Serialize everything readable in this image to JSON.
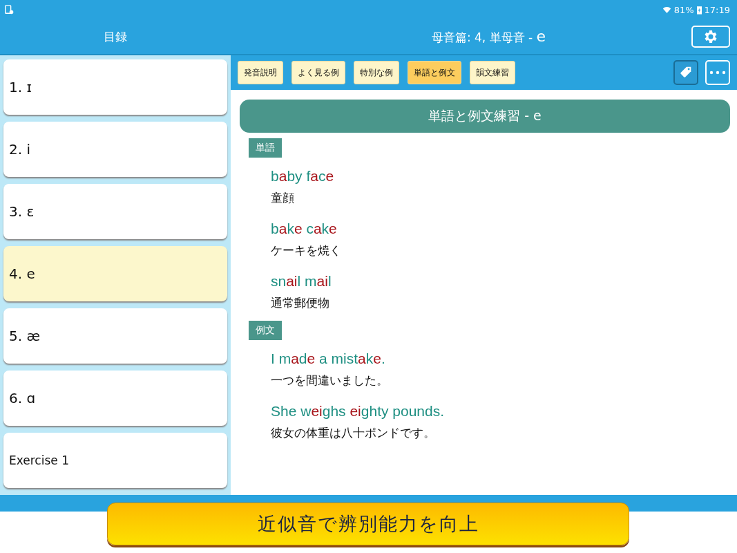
{
  "status_bar": {
    "battery": "81%",
    "time": "17:19"
  },
  "header": {
    "sidebar_title": "目録",
    "title": "母音篇: 4,  単母音 - ",
    "title_symbol": "e"
  },
  "sidebar": {
    "items": [
      {
        "label": "1. ɪ",
        "selected": false
      },
      {
        "label": "2. i",
        "selected": false
      },
      {
        "label": "3. ɛ",
        "selected": false
      },
      {
        "label": "4. e",
        "selected": true
      },
      {
        "label": "5. æ",
        "selected": false
      },
      {
        "label": "6. ɑ",
        "selected": false
      },
      {
        "label": "Exercise 1",
        "selected": false
      }
    ]
  },
  "tabs": [
    {
      "label": "発音説明",
      "selected": false
    },
    {
      "label": "よく見る例",
      "selected": false
    },
    {
      "label": "特別な例",
      "selected": false
    },
    {
      "label": "単語と例文",
      "selected": true
    },
    {
      "label": "韻文練習",
      "selected": false
    }
  ],
  "content": {
    "heading": "単語と例文練習 - e",
    "sections": [
      {
        "label": "単語",
        "entries": [
          {
            "phrase": [
              {
                "t": "b",
                "hl": false
              },
              {
                "t": "a",
                "hl": true
              },
              {
                "t": "by f",
                "hl": false
              },
              {
                "t": "a",
                "hl": true
              },
              {
                "t": "c",
                "hl": false
              },
              {
                "t": "e",
                "hl": true
              }
            ],
            "meaning": "童顔"
          },
          {
            "phrase": [
              {
                "t": "b",
                "hl": false
              },
              {
                "t": "a",
                "hl": true
              },
              {
                "t": "k",
                "hl": false
              },
              {
                "t": "e",
                "hl": true
              },
              {
                "t": " c",
                "hl": false
              },
              {
                "t": "a",
                "hl": true
              },
              {
                "t": "k",
                "hl": false
              },
              {
                "t": "e",
                "hl": true
              }
            ],
            "meaning": "ケーキを焼く"
          },
          {
            "phrase": [
              {
                "t": "sn",
                "hl": false
              },
              {
                "t": "ai",
                "hl": true
              },
              {
                "t": "l m",
                "hl": false
              },
              {
                "t": "ai",
                "hl": true
              },
              {
                "t": "l",
                "hl": false
              }
            ],
            "meaning": "通常郵便物"
          }
        ]
      },
      {
        "label": "例文",
        "entries": [
          {
            "phrase": [
              {
                "t": "I m",
                "hl": false
              },
              {
                "t": "a",
                "hl": true
              },
              {
                "t": "d",
                "hl": false
              },
              {
                "t": "e",
                "hl": true
              },
              {
                "t": " a mist",
                "hl": false
              },
              {
                "t": "a",
                "hl": true
              },
              {
                "t": "k",
                "hl": false
              },
              {
                "t": "e",
                "hl": true
              },
              {
                "t": ".",
                "hl": false
              }
            ],
            "meaning": "一つを間違いました。"
          },
          {
            "phrase": [
              {
                "t": "She w",
                "hl": false
              },
              {
                "t": "ei",
                "hl": true
              },
              {
                "t": "ghs ",
                "hl": false
              },
              {
                "t": "ei",
                "hl": true
              },
              {
                "t": "ghty pounds.",
                "hl": false
              }
            ],
            "meaning": "彼女の体重は八十ポンドです。"
          }
        ]
      }
    ]
  },
  "banner": {
    "label": "近似音で辨別能力を向上"
  }
}
